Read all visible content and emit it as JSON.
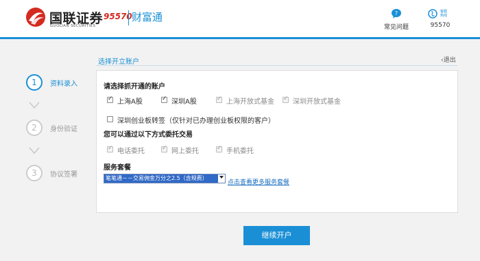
{
  "header": {
    "brand_cn": "国联证券",
    "brand_en": "GUOLIAN SECURITIES",
    "hotline_badge": "95570",
    "product_name": "财富通",
    "faq_label": "常见问题",
    "hotline_icon_text": "客服热线",
    "hotline_label": "95570",
    "faq_icon_text": "?",
    "brand_color": "#d42b21",
    "accent_color": "#1a8fd6"
  },
  "steps": [
    {
      "num": "1",
      "label": "资料录入",
      "active": true
    },
    {
      "num": "2",
      "label": "身份验证",
      "active": false
    },
    {
      "num": "3",
      "label": "协议签署",
      "active": false
    }
  ],
  "section": {
    "title": "选择开立账户",
    "back": "退出"
  },
  "accounts": {
    "heading": "请选择抓开通的账户",
    "options": [
      {
        "label": "上海A股",
        "checked": true,
        "disabled": false
      },
      {
        "label": "深圳A股",
        "checked": true,
        "disabled": false
      },
      {
        "label": "上海开放式基金",
        "checked": true,
        "disabled": true
      },
      {
        "label": "深圳开放式基金",
        "checked": true,
        "disabled": true
      }
    ],
    "gem": {
      "label": "深圳创业板转签（仅针对已办理创业板权限的客户）",
      "checked": false
    }
  },
  "trade": {
    "heading": "您可以通过以下方式委托交易",
    "options": [
      {
        "label": "电话委托",
        "checked": true,
        "disabled": true
      },
      {
        "label": "网上委托",
        "checked": true,
        "disabled": true
      },
      {
        "label": "手机委托",
        "checked": true,
        "disabled": true
      }
    ]
  },
  "service": {
    "heading": "服务套餐",
    "selected": "笔笔通－－交易佣金万分之2.5（含规费）",
    "more_link": "点击查看更多服务套餐"
  },
  "submit_label": "继续开户"
}
